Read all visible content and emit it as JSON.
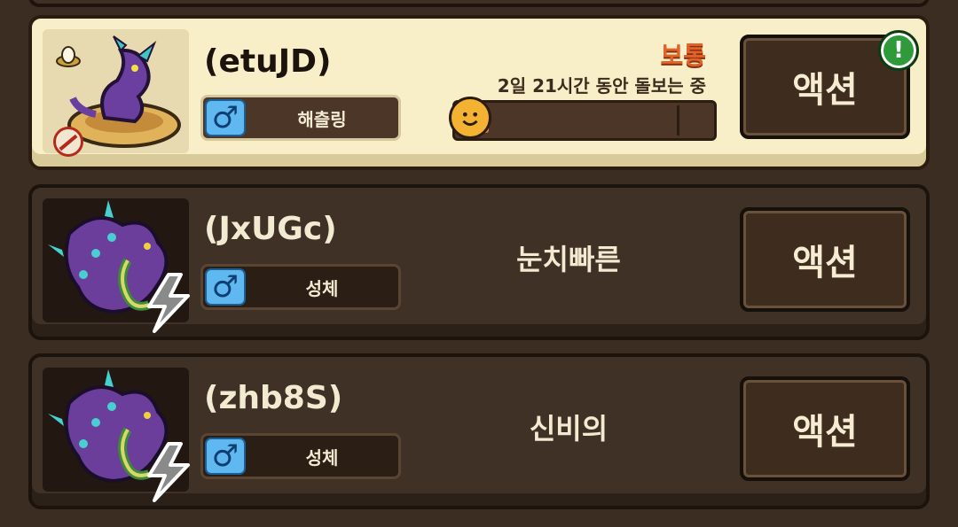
{
  "colors": {
    "background": "#3b2d22",
    "selected_card": "#f8efc9",
    "mood_text": "#e0642a",
    "gender_blue": "#5fb8f0",
    "alert_green": "#2f9a3a",
    "progress_fill": "#e8823a"
  },
  "pets": [
    {
      "name": "(etuJD)",
      "gender_icon": "male-symbol-icon",
      "gender_symbol": "♂",
      "stage": "해츨링",
      "mood": "보통",
      "care_status": "2일 21시간 동안 돌보는 중",
      "mood_progress": 0.05,
      "action_label": "액션",
      "alert": "!",
      "selected": true
    },
    {
      "name": "(JxUGc)",
      "gender_icon": "male-symbol-icon",
      "gender_symbol": "♂",
      "stage": "성체",
      "personality": "눈치빠른",
      "action_label": "액션",
      "selected": false
    },
    {
      "name": "(zhb8S)",
      "gender_icon": "male-symbol-icon",
      "gender_symbol": "♂",
      "stage": "성체",
      "personality": "신비의",
      "action_label": "액션",
      "selected": false
    }
  ]
}
